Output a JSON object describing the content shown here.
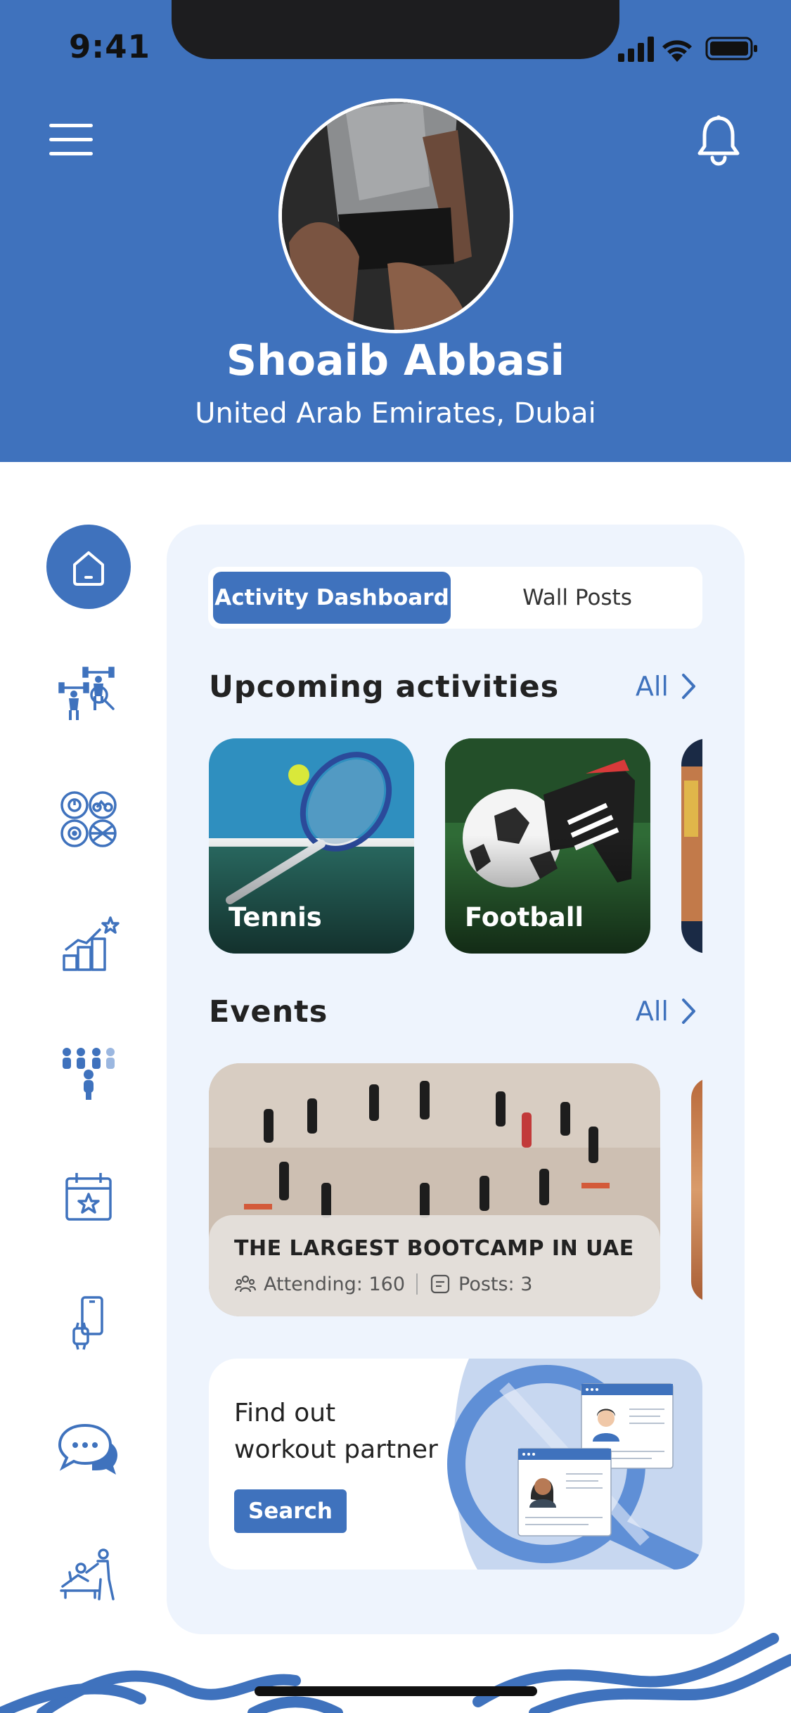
{
  "status_bar": {
    "time": "9:41"
  },
  "profile": {
    "name": "Shoaib Abbasi",
    "location": "United Arab Emirates, Dubai"
  },
  "sidebar": {
    "items": [
      {
        "icon": "home-icon",
        "active": true
      },
      {
        "icon": "fitness-trainers-icon",
        "active": false
      },
      {
        "icon": "sports-categories-icon",
        "active": false
      },
      {
        "icon": "progress-chart-icon",
        "active": false
      },
      {
        "icon": "community-icon",
        "active": false
      },
      {
        "icon": "calendar-star-icon",
        "active": false
      },
      {
        "icon": "devices-icon",
        "active": false
      },
      {
        "icon": "chat-icon",
        "active": false
      },
      {
        "icon": "physiotherapy-icon",
        "active": false
      }
    ]
  },
  "tabs": [
    {
      "label": "Activity Dashboard",
      "active": true
    },
    {
      "label": "Wall Posts",
      "active": false
    }
  ],
  "upcoming": {
    "title": "Upcoming activities",
    "all_label": "All",
    "items": [
      {
        "label": "Tennis"
      },
      {
        "label": "Football"
      }
    ]
  },
  "events": {
    "title": "Events",
    "all_label": "All",
    "items": [
      {
        "title": "THE LARGEST BOOTCAMP IN UAE",
        "attending": "Attending: 160",
        "posts": "Posts: 3"
      }
    ]
  },
  "partner": {
    "line1": "Find out",
    "line2": "workout partner",
    "button": "Search"
  },
  "colors": {
    "primary": "#3f72bd",
    "panel": "#eef4fd"
  }
}
